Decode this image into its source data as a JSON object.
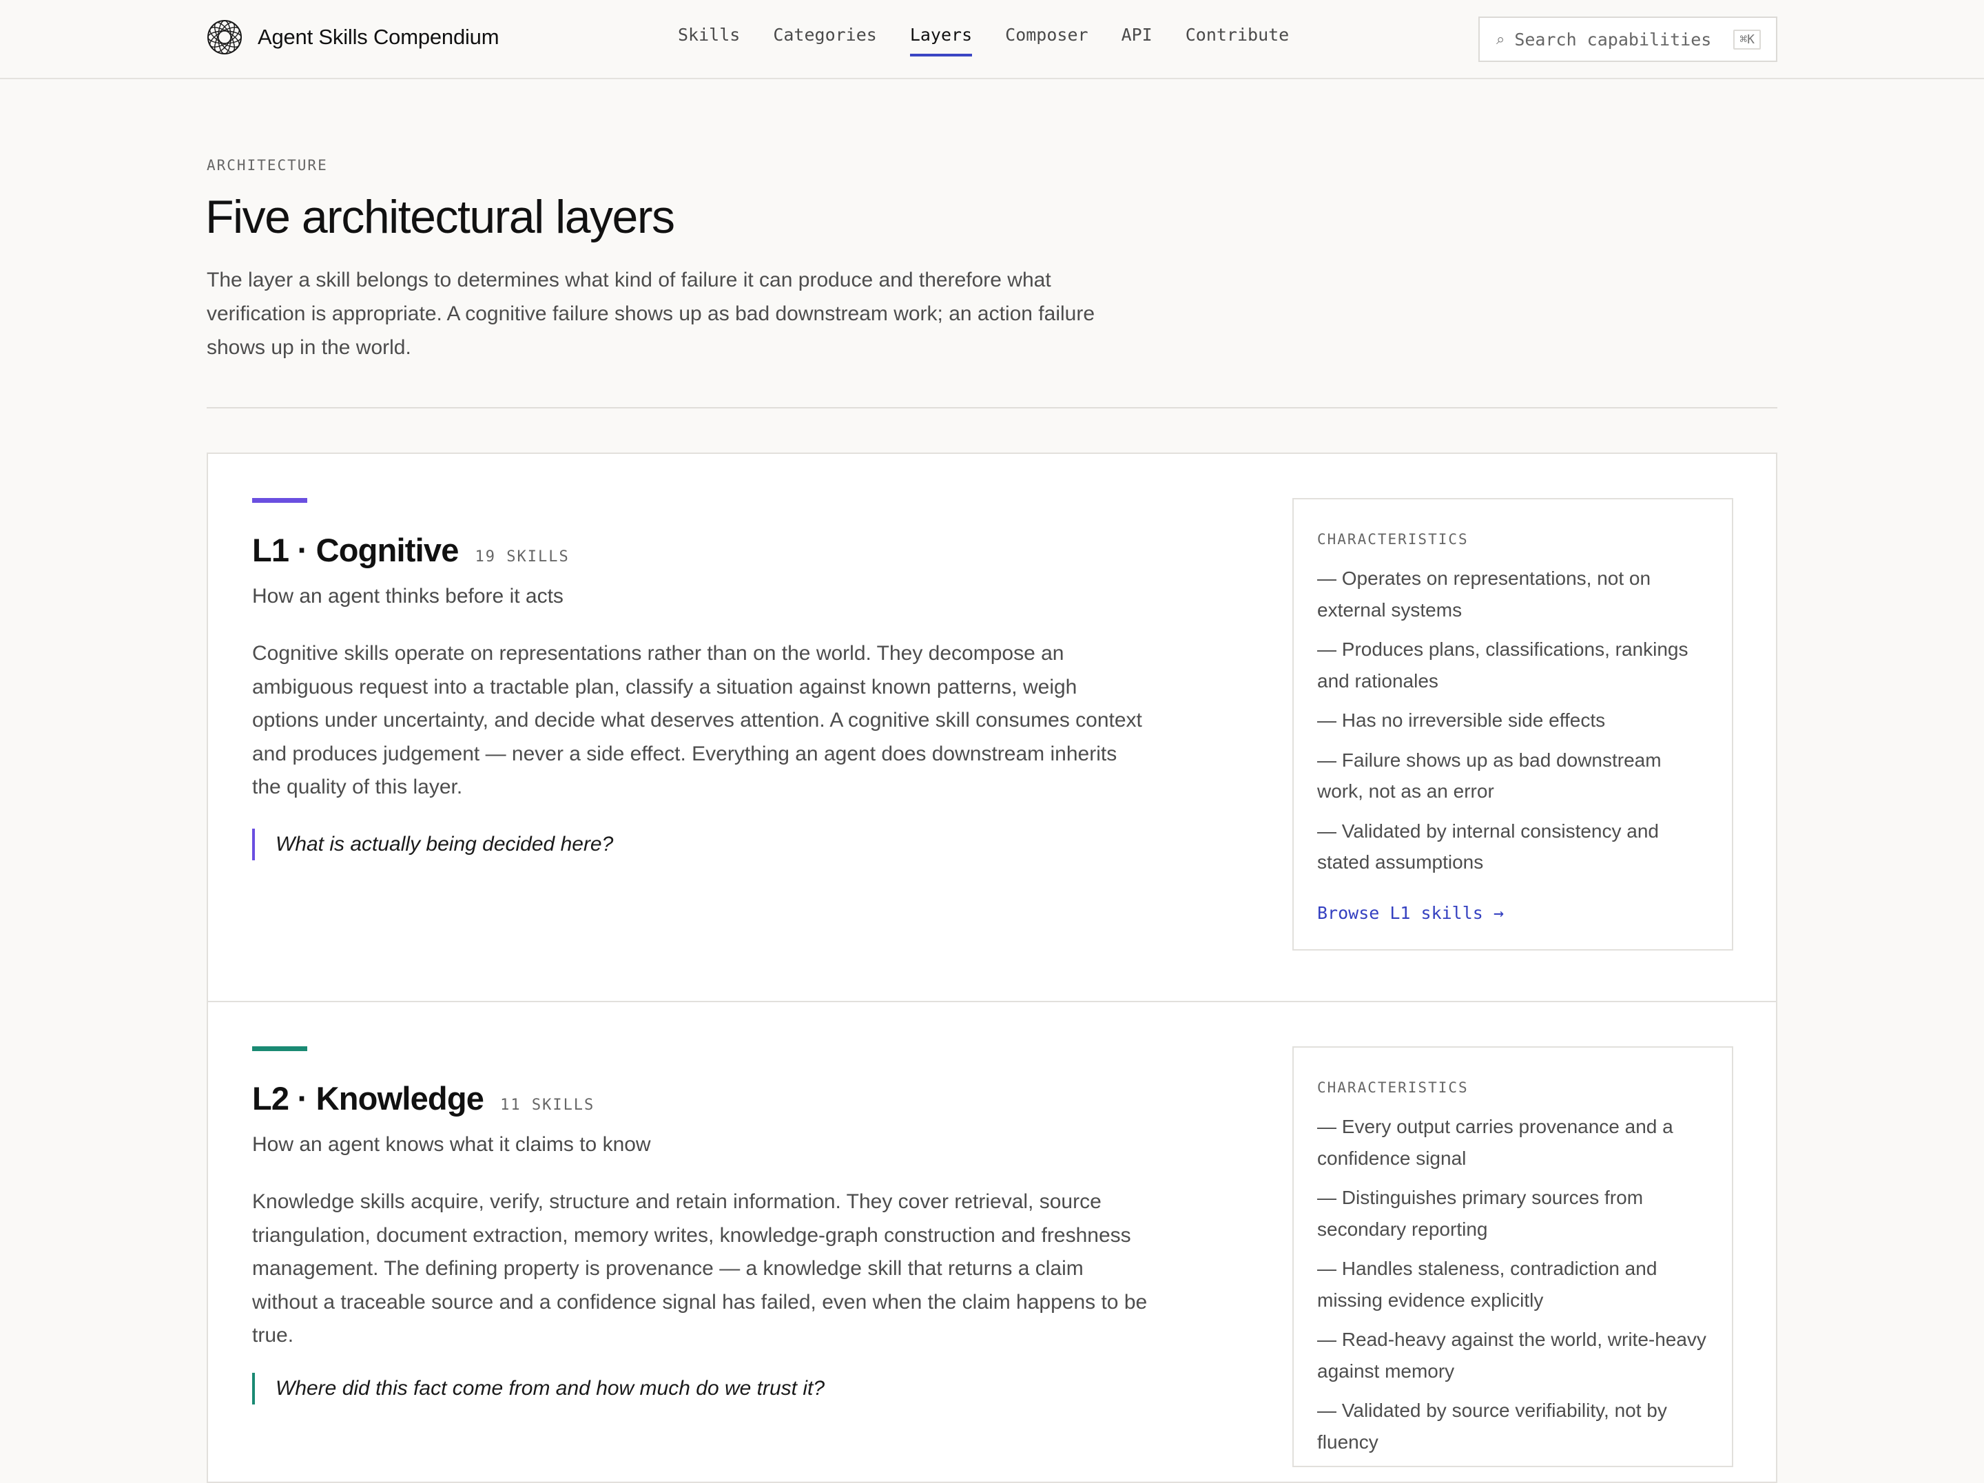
{
  "header": {
    "brand_name": "Agent Skills Compendium",
    "nav": [
      {
        "label": "Skills"
      },
      {
        "label": "Categories"
      },
      {
        "label": "Layers",
        "active": true
      },
      {
        "label": "Composer"
      },
      {
        "label": "API"
      },
      {
        "label": "Contribute"
      }
    ],
    "search": {
      "placeholder": "Search capabilities",
      "shortcut": "⌘K",
      "icon": "search-icon"
    }
  },
  "intro": {
    "eyebrow": "ARCHITECTURE",
    "title": "Five architectural layers",
    "lede": "The layer a skill belongs to determines what kind of failure it can produce and therefore what verification is appropriate. A cognitive failure shows up as bad downstream work; an action failure shows up in the world."
  },
  "layers": [
    {
      "title": "L1 · Cognitive",
      "count": "19 SKILLS",
      "accent_color": "#6a4fe0",
      "tagline": "How an agent thinks before it acts",
      "body": "Cognitive skills operate on representations rather than on the world. They decompose an ambiguous request into a tractable plan, classify a situation against known patterns, weigh options under uncertainty, and decide what deserves attention. A cognitive skill consumes context and produces judgement — never a side effect. Everything an agent does downstream inherits the quality of this layer.",
      "quote": "What is actually being decided here?",
      "characteristics_label": "CHARACTERISTICS",
      "characteristics": [
        "— Operates on representations, not on external systems",
        "— Produces plans, classifications, rankings and rationales",
        "— Has no irreversible side effects",
        "— Failure shows up as bad downstream work, not as an error",
        "— Validated by internal consistency and stated assumptions"
      ],
      "link": "Browse L1 skills →"
    },
    {
      "title": "L2 · Knowledge",
      "count": "11 SKILLS",
      "accent_color": "#1a8a73",
      "tagline": "How an agent knows what it claims to know",
      "body": "Knowledge skills acquire, verify, structure and retain information. They cover retrieval, source triangulation, document extraction, memory writes, knowledge-graph construction and freshness management. The defining property is provenance — a knowledge skill that returns a claim without a traceable source and a confidence signal has failed, even when the claim happens to be true.",
      "quote": "Where did this fact come from and how much do we trust it?",
      "characteristics_label": "CHARACTERISTICS",
      "characteristics": [
        "— Every output carries provenance and a confidence signal",
        "— Distinguishes primary sources from secondary reporting",
        "— Handles staleness, contradiction and missing evidence explicitly",
        "— Read-heavy against the world, write-heavy against memory",
        "— Validated by source verifiability, not by fluency"
      ]
    }
  ]
}
